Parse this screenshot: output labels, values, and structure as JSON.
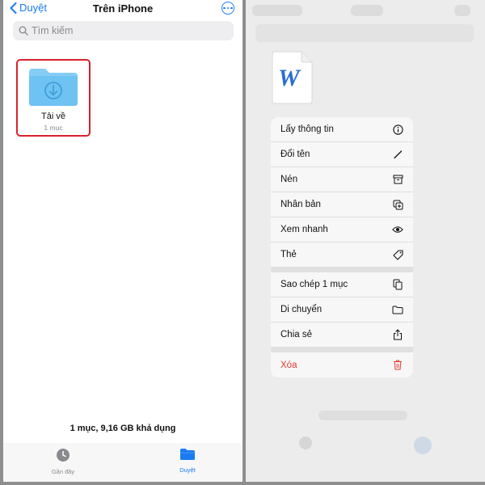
{
  "left": {
    "nav": {
      "back_label": "Duyệt",
      "title": "Trên iPhone"
    },
    "search": {
      "placeholder": "Tìm kiếm"
    },
    "folder": {
      "name": "Tải về",
      "count": "1 mục"
    },
    "storage": "1 mục, 9,16 GB khả dụng",
    "tabs": {
      "recent": "Gần đây",
      "browse": "Duyệt"
    }
  },
  "right": {
    "doc_icon": "word-document-icon",
    "menu": {
      "group1": [
        {
          "label": "Lấy thông tin",
          "icon": "info-icon"
        },
        {
          "label": "Đổi tên",
          "icon": "pencil-icon"
        },
        {
          "label": "Nén",
          "icon": "archive-icon"
        },
        {
          "label": "Nhân bản",
          "icon": "duplicate-icon"
        },
        {
          "label": "Xem nhanh",
          "icon": "eye-icon"
        },
        {
          "label": "Thẻ",
          "icon": "tag-icon"
        }
      ],
      "group2": [
        {
          "label": "Sao chép 1 mục",
          "icon": "copy-icon"
        },
        {
          "label": "Di chuyển",
          "icon": "folder-icon"
        },
        {
          "label": "Chia sẻ",
          "icon": "share-icon"
        }
      ],
      "group3": [
        {
          "label": "Xóa",
          "icon": "trash-icon"
        }
      ]
    }
  },
  "colors": {
    "accent": "#1a7bf2",
    "highlight": "#d9222a",
    "danger": "#e5392f",
    "folder": "#6fc3f2"
  }
}
